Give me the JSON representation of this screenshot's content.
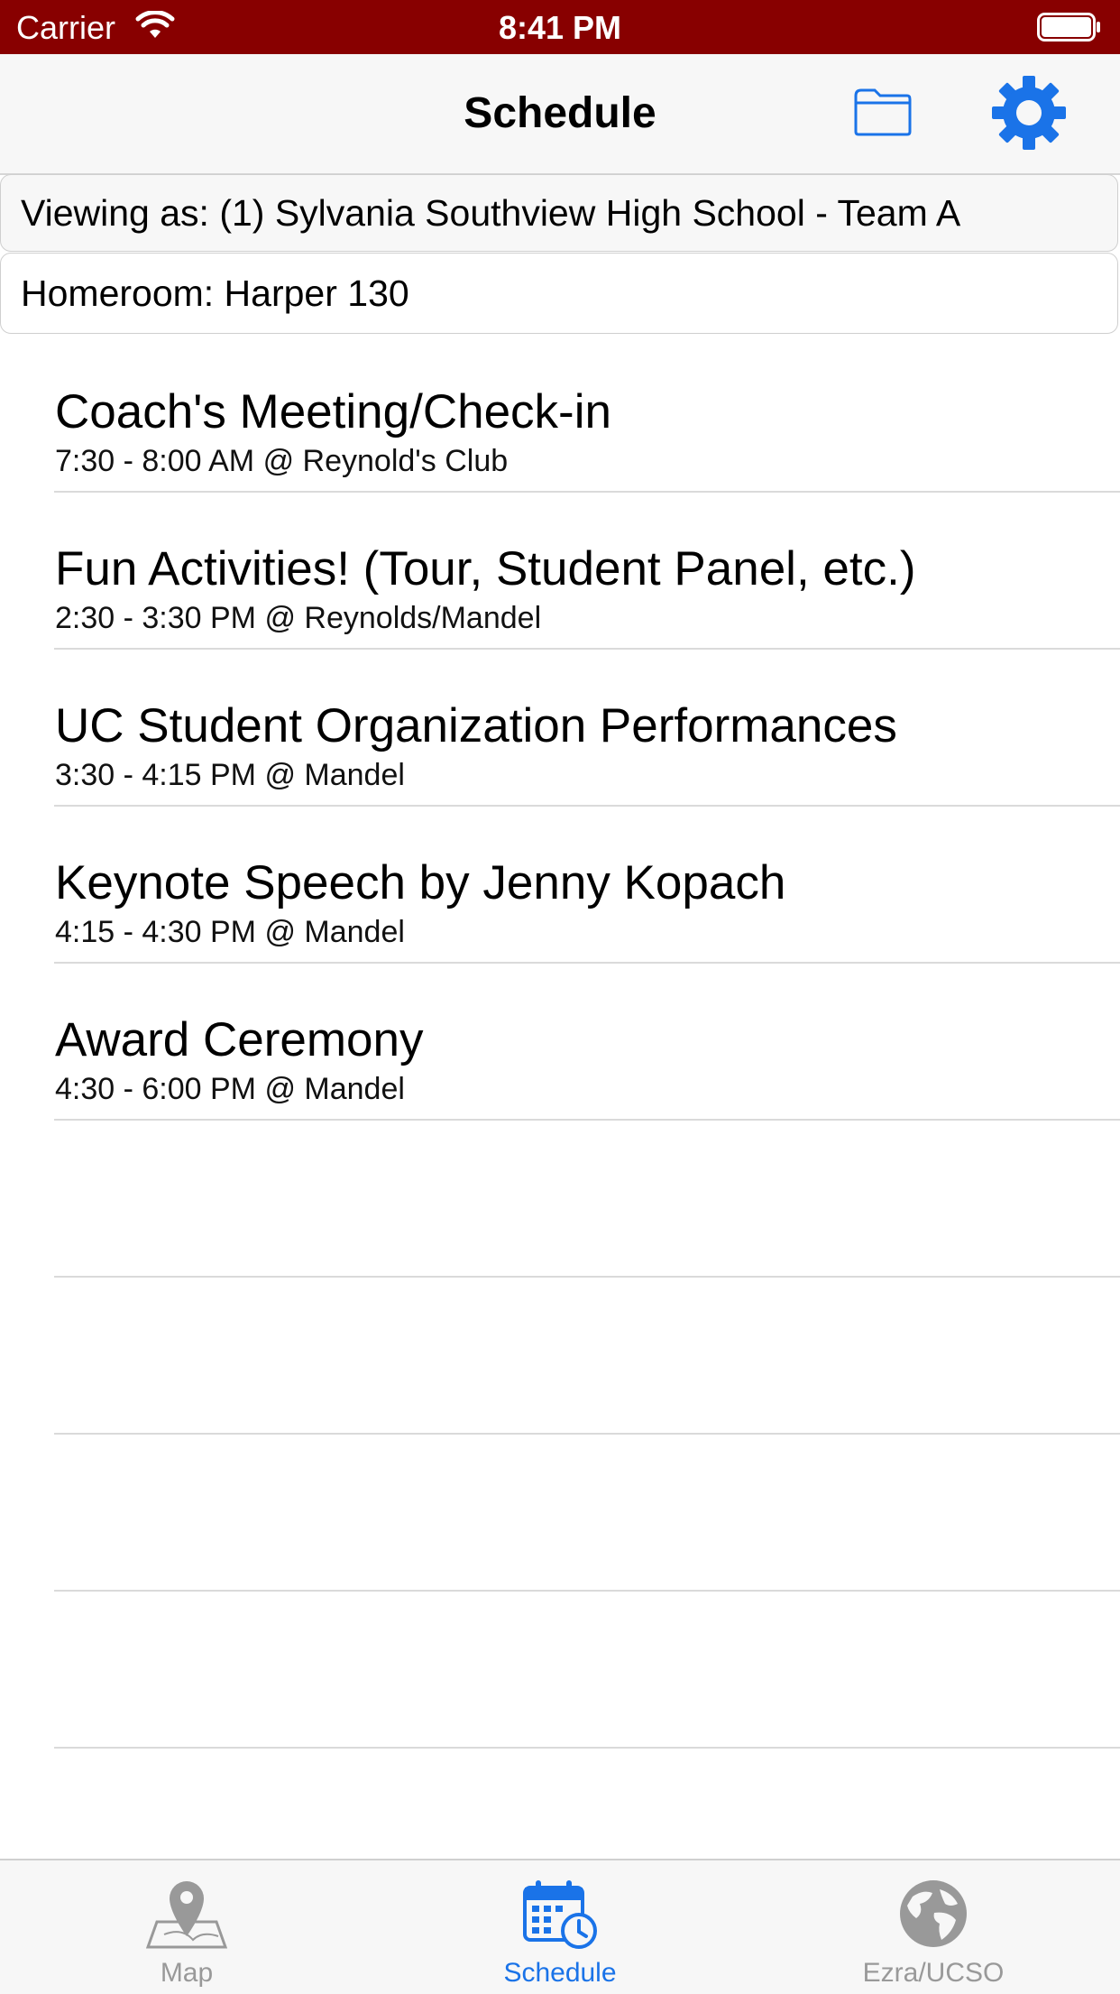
{
  "status_bar": {
    "carrier": "Carrier",
    "time": "8:41 PM",
    "background": "#880000"
  },
  "nav": {
    "title": "Schedule",
    "folder_icon": "folder-icon",
    "settings_icon": "gear-icon",
    "accent": "#1a73e8"
  },
  "info": {
    "viewing_as": "Viewing as: (1) Sylvania Southview High School - Team A",
    "homeroom": "Homeroom: Harper 130"
  },
  "events": [
    {
      "title": "Coach's Meeting/Check-in",
      "detail": "7:30 - 8:00 AM @ Reynold's Club"
    },
    {
      "title": "Fun Activities! (Tour, Student Panel, etc.)",
      "detail": "2:30 - 3:30 PM @ Reynolds/Mandel"
    },
    {
      "title": "UC Student Organization Performances",
      "detail": "3:30 - 4:15 PM @ Mandel"
    },
    {
      "title": "Keynote Speech by Jenny Kopach",
      "detail": "4:15 - 4:30 PM @ Mandel"
    },
    {
      "title": "Award Ceremony",
      "detail": "4:30 - 6:00 PM @ Mandel"
    }
  ],
  "tabs": [
    {
      "label": "Map",
      "icon": "map-pin-icon",
      "selected": false
    },
    {
      "label": "Schedule",
      "icon": "calendar-clock-icon",
      "selected": true
    },
    {
      "label": "Ezra/UCSO",
      "icon": "globe-icon",
      "selected": false
    }
  ]
}
